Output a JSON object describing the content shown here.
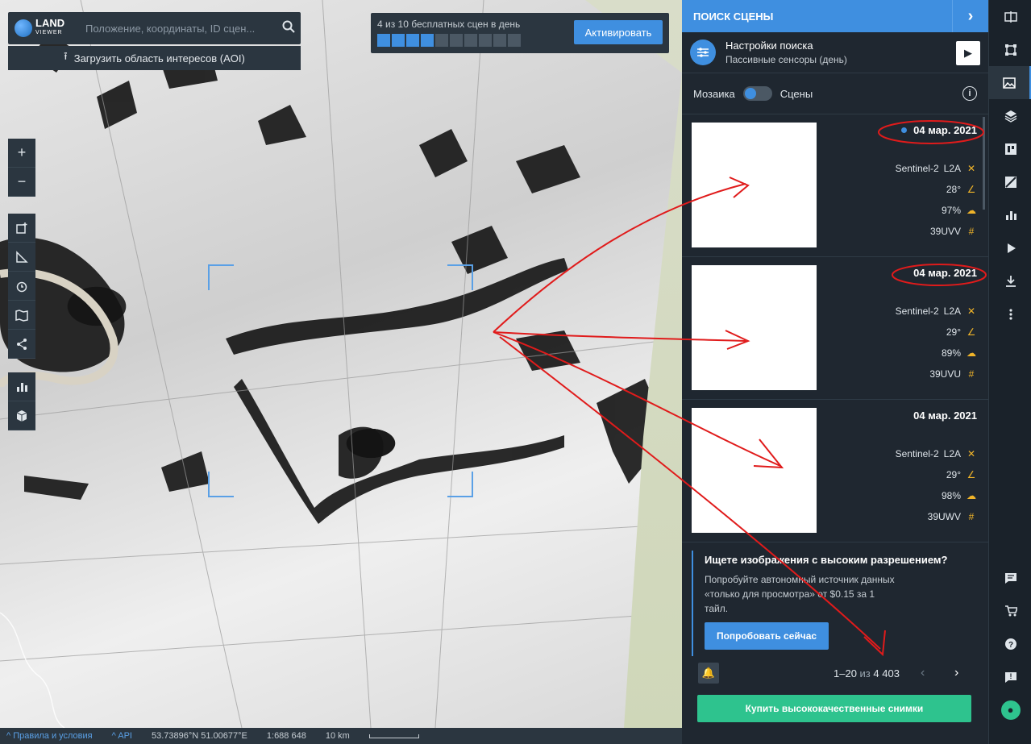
{
  "search": {
    "logo_text": "LAND",
    "logo_sub": "VIEWER",
    "placeholder": "Положение, координаты, ID сцен...",
    "aoi_label": "Загрузить область интересов (AOI)"
  },
  "banner": {
    "text": "4 из 10 бесплатных сцен в день",
    "activate_label": "Активировать",
    "used": 4,
    "total": 10
  },
  "map_tools": {
    "zoom_in": "+",
    "zoom_out": "−"
  },
  "status": {
    "terms": "Правила и условия",
    "api": "API",
    "coords": "53.73896°N 51.00677°E",
    "scale": "1:688 648",
    "distance": "10 km"
  },
  "panel": {
    "title": "ПОИСК СЦЕНЫ",
    "settings_title": "Настройки поиска",
    "settings_sub": "Пассивные сенсоры (день)",
    "mosaic_label": "Мозаика",
    "scenes_label": "Сцены",
    "scenes": [
      {
        "date": "04 мар. 2021",
        "sensor": "Sentinel-2",
        "level": "L2A",
        "angle": "28°",
        "cloud": "97%",
        "tile": "39UVV",
        "selected": true
      },
      {
        "date": "04 мар. 2021",
        "sensor": "Sentinel-2",
        "level": "L2A",
        "angle": "29°",
        "cloud": "89%",
        "tile": "39UVU",
        "selected": false
      },
      {
        "date": "04 мар. 2021",
        "sensor": "Sentinel-2",
        "level": "L2A",
        "angle": "29°",
        "cloud": "98%",
        "tile": "39UWV",
        "selected": false
      }
    ],
    "promo": {
      "title": "Ищете изображения с высоким разрешением?",
      "body": "Попробуйте автономный источник данных «только для просмотра» от $0.15 за 1 тайл.",
      "button": "Попробовать сейчас"
    },
    "pager": {
      "range": "1–20",
      "of": "из",
      "total": "4 403"
    },
    "buy_label": "Купить высококачественные снимки"
  },
  "colors": {
    "accent": "#3f8fe0",
    "buy": "#2ec38e",
    "panel_bg": "#1f2730",
    "annotation": "#e01b1b"
  }
}
